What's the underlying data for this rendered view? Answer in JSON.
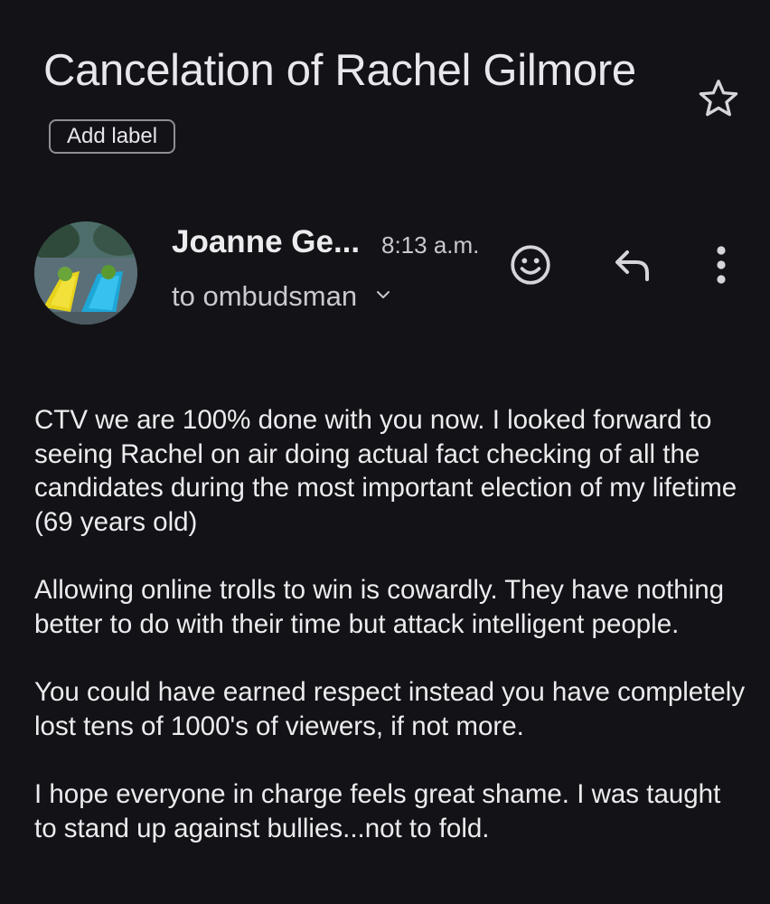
{
  "email": {
    "subject": "Cancelation of Rachel Gilmore",
    "add_label": "Add label",
    "sender_name": "Joanne Ge...",
    "time": "8:13 a.m.",
    "recipient": "to ombudsman",
    "body_paragraphs": [
      "CTV we are 100% done with you now. I looked forward to seeing Rachel on air doing actual fact checking of all the candidates during the most important election of my lifetime (69 years old)",
      "Allowing online trolls to win is cowardly. They have nothing better to do with their time but attack intelligent people.",
      "You could have earned respect instead you have completely lost tens of 1000's of viewers, if not more.",
      "I hope everyone in charge feels great shame. I was taught to stand up against bullies...not to fold."
    ]
  },
  "icons": {
    "star": "star-outline-icon",
    "emoji": "add-reaction-icon",
    "reply": "reply-icon",
    "more": "more-vert-icon",
    "recipient_details": "chevron-down-icon"
  }
}
